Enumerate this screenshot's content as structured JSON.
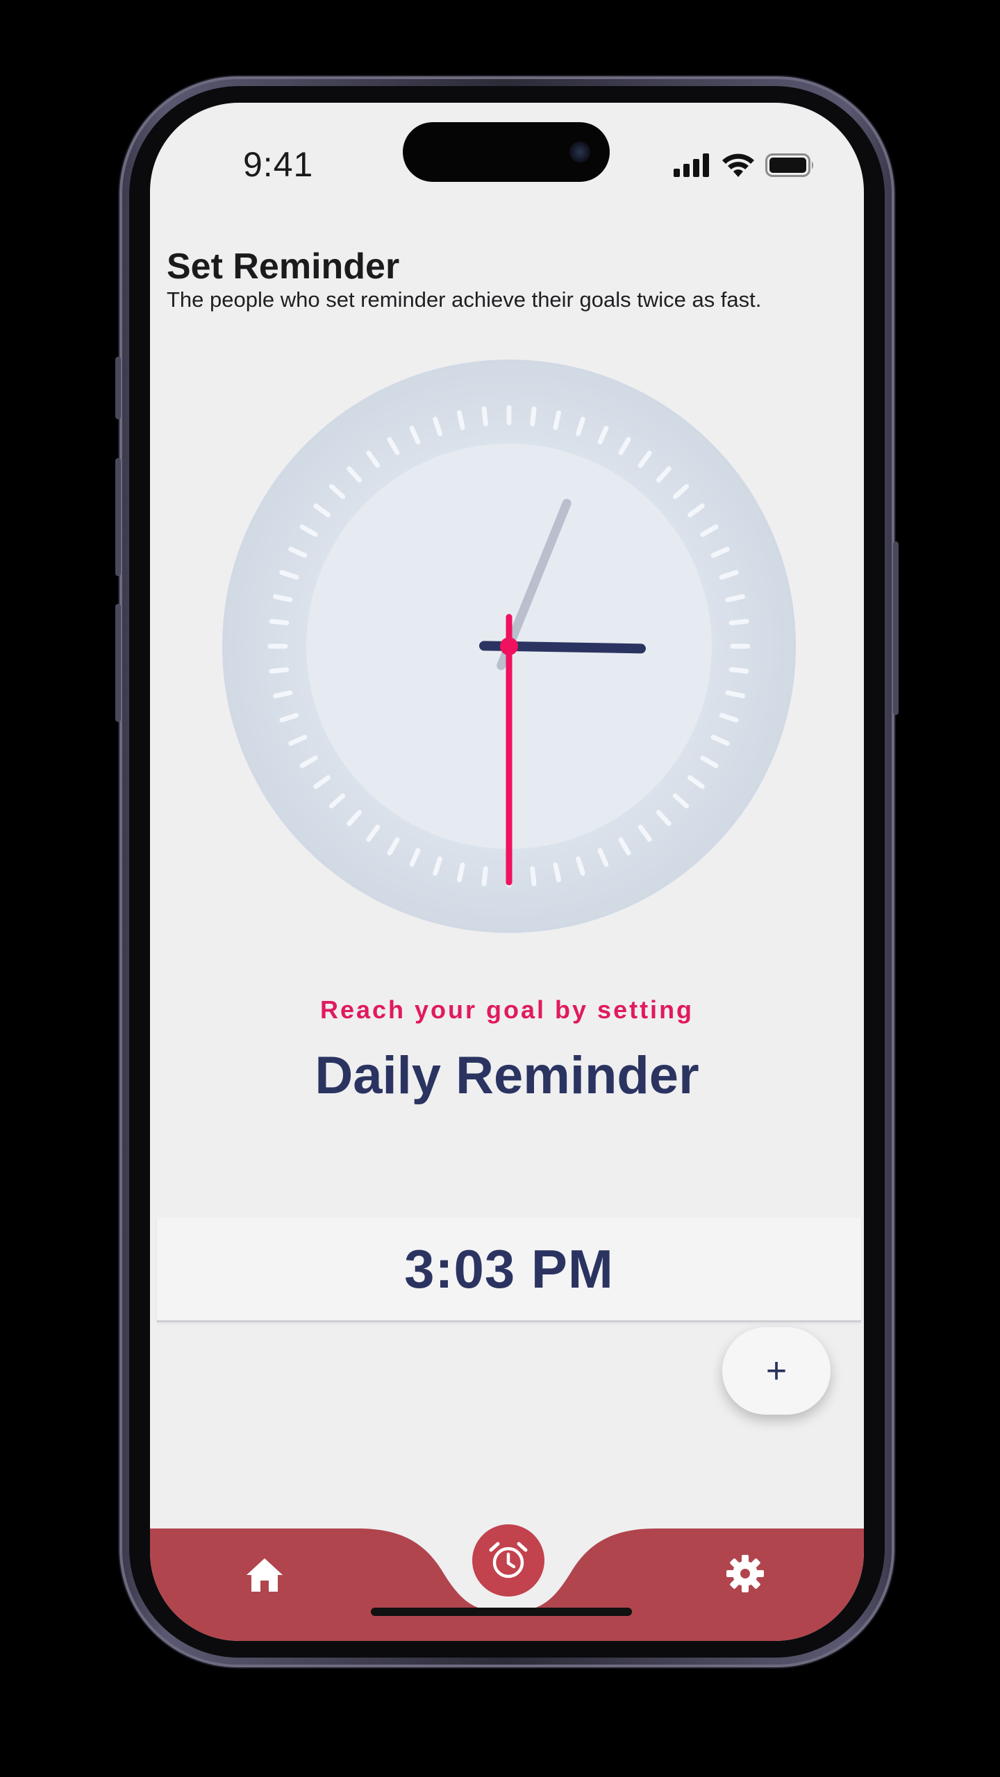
{
  "status_bar": {
    "time": "9:41",
    "icons": [
      "cellular-signal-icon",
      "wifi-icon",
      "battery-icon"
    ]
  },
  "header": {
    "title": "Set Reminder",
    "subtitle": "The people who set reminder achieve their goals twice as fast."
  },
  "clock": {
    "hour": 3,
    "minute": 3,
    "second": 30,
    "colors": {
      "outer_ring": "#d6dee8",
      "face": "#e6ebf1",
      "tick": "#f3f6fa",
      "hour_hand": "#b9bfcd",
      "minute_hand": "#2b3460",
      "second_hand": "#f0125e"
    }
  },
  "main": {
    "tagline": "Reach your goal by setting",
    "headline": "Daily Reminder",
    "selected_time": "3:03 PM",
    "add_button_label": "+"
  },
  "bottom_nav": {
    "items": [
      {
        "name": "home",
        "icon": "home-icon"
      },
      {
        "name": "alarm",
        "icon": "alarm-clock-icon"
      },
      {
        "name": "settings",
        "icon": "gear-icon"
      }
    ],
    "colors": {
      "bar": "#b0454e",
      "center_button": "#c2424d",
      "icon": "#ffffff"
    }
  },
  "colors": {
    "background": "#efeff0",
    "accent": "#e01a5e",
    "primary_text": "#2b3460"
  }
}
